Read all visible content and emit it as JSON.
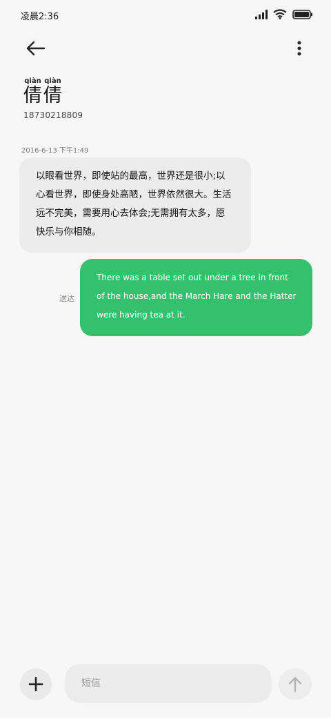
{
  "status_bar": {
    "time": "凌晨2:36",
    "icons": [
      "signal-icon",
      "wifi-icon",
      "battery-icon"
    ]
  },
  "header": {
    "back_icon": "back-arrow-icon",
    "more_icon": "more-vertical-icon",
    "contact": {
      "name_chars": [
        {
          "pinyin": "qiàn",
          "char": "倩"
        },
        {
          "pinyin": "qiàn",
          "char": "倩"
        }
      ],
      "phone": "18730218809"
    }
  },
  "conversation": {
    "timestamp": "2016-6-13 下午1:49",
    "received": {
      "text": "以眼看世界，即使站的最高，世界还是很小;以心看世界，即使身处高陋，世界依然很大。生活远不完美，需要用心去体会;无需拥有太多，愿快乐与你相随。"
    },
    "sent": {
      "label": "送达",
      "text": "There was a table set out under a tree in front of the house,and the March Hare and the Hatter were having tea at it."
    }
  },
  "composer": {
    "add_icon": "plus-icon",
    "placeholder": "短信",
    "send_icon": "send-arrow-up-icon"
  },
  "colors": {
    "sent_bubble": "#34c16d",
    "received_bubble": "#ececec",
    "background": "#f7f7f7"
  }
}
